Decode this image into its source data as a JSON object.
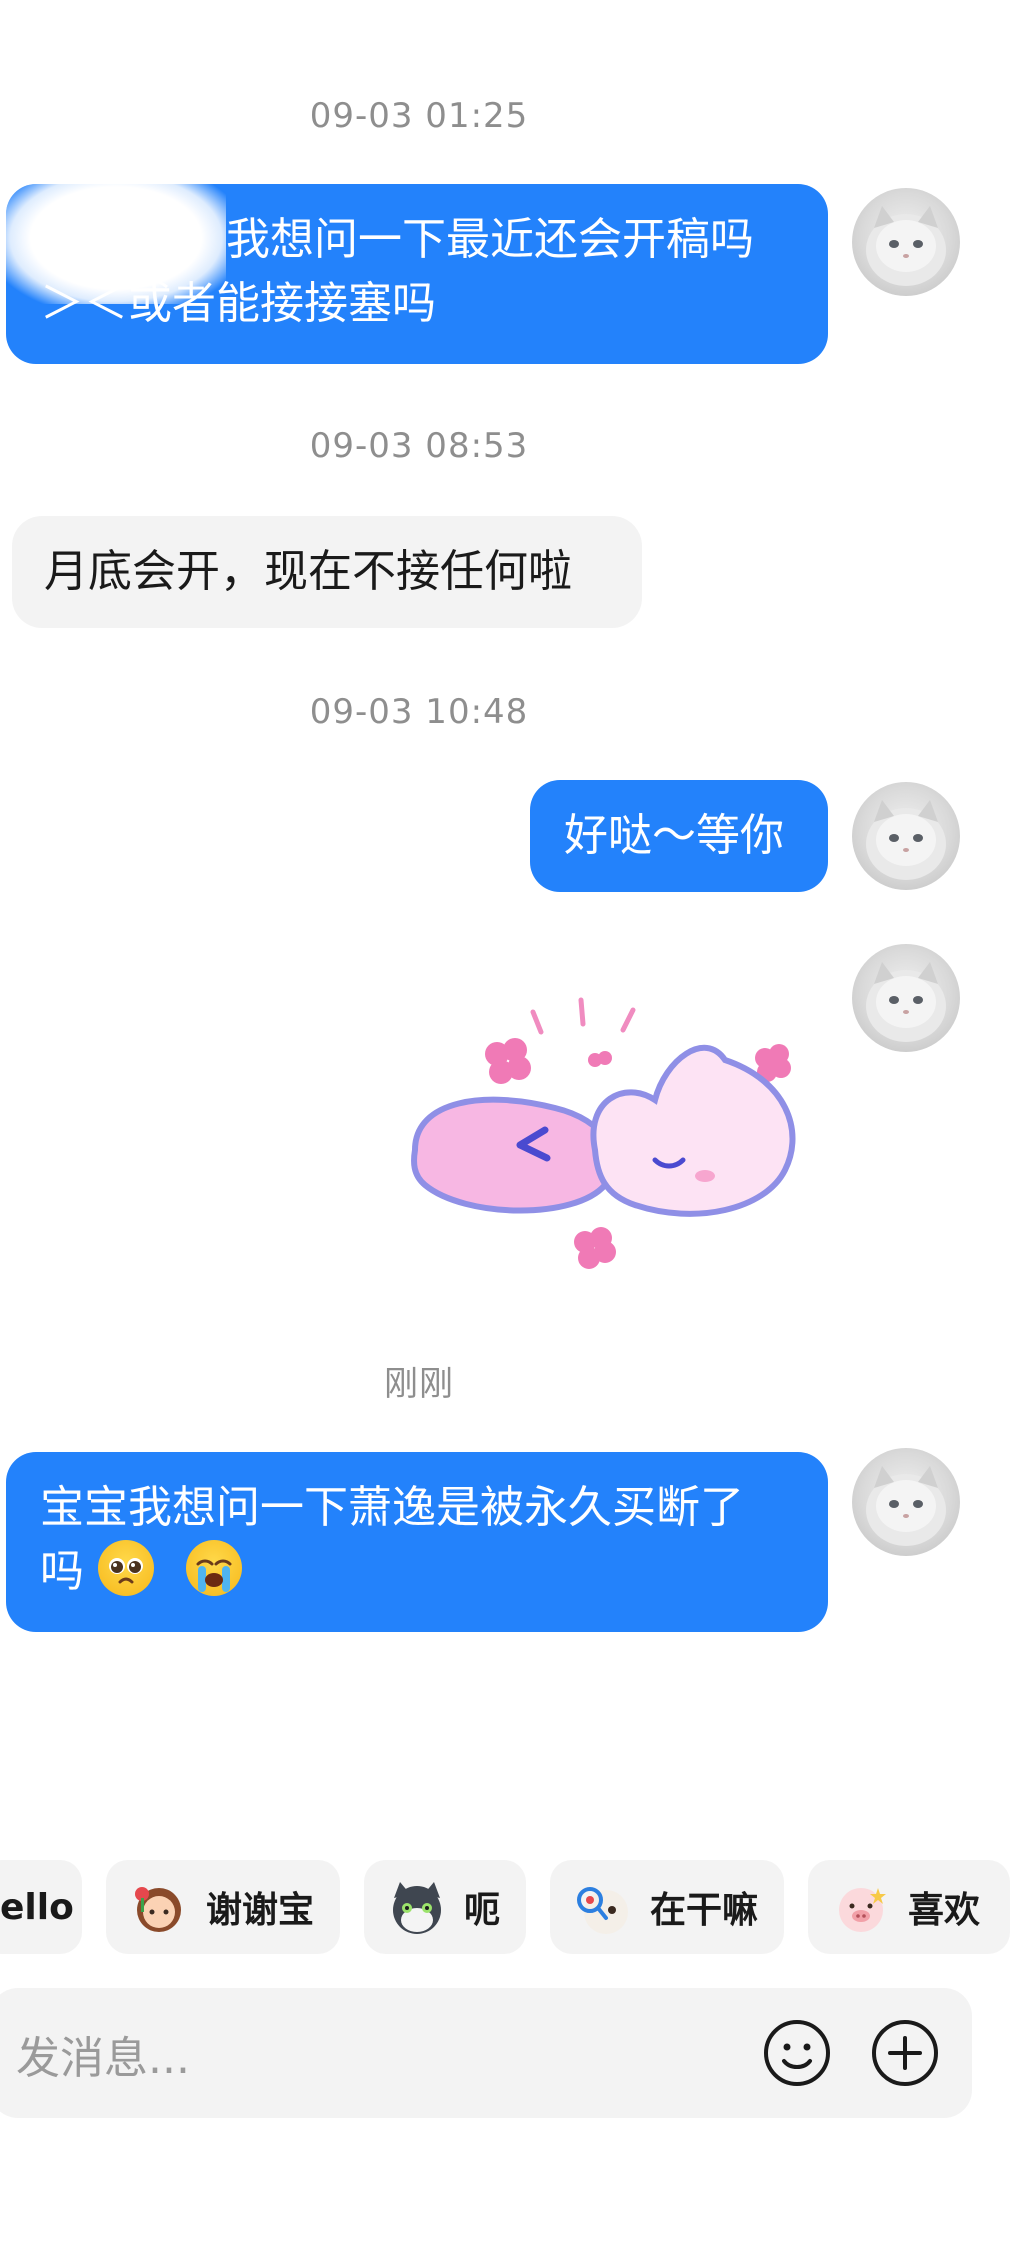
{
  "conversation": {
    "timestamps": [
      "09-03 01:25",
      "09-03 08:53",
      "09-03 10:48",
      "刚刚"
    ],
    "messages": [
      {
        "text": "我想问一下最近还会开稿吗\n＞＜或者能接接塞吗",
        "line1": "我想问一下最近还会开稿吗",
        "line2": "＞＜或者能接接塞吗",
        "side": "sent"
      },
      {
        "text": "月底会开，现在不接任何啦",
        "side": "received"
      },
      {
        "text": "好哒～等你",
        "side": "sent"
      },
      {
        "type": "sticker",
        "side": "sent"
      },
      {
        "line1": "宝宝我想问一下萧逸是被永久买断了",
        "line2": "吗",
        "side": "sent"
      }
    ]
  },
  "quick_replies": [
    {
      "label": "ello",
      "icon": ""
    },
    {
      "label": "谢谢宝",
      "icon": "girl-flower-icon"
    },
    {
      "label": "呃",
      "icon": "cat-icon"
    },
    {
      "label": "在干嘛",
      "icon": "magnifier-face-icon"
    },
    {
      "label": "喜欢",
      "icon": "piggy-face-icon"
    }
  ],
  "composer": {
    "placeholder": "发消息..."
  },
  "colors": {
    "sent_bubble": "#2382fb",
    "received_bubble": "#f3f3f3",
    "timestamp": "#8e8e8e"
  }
}
